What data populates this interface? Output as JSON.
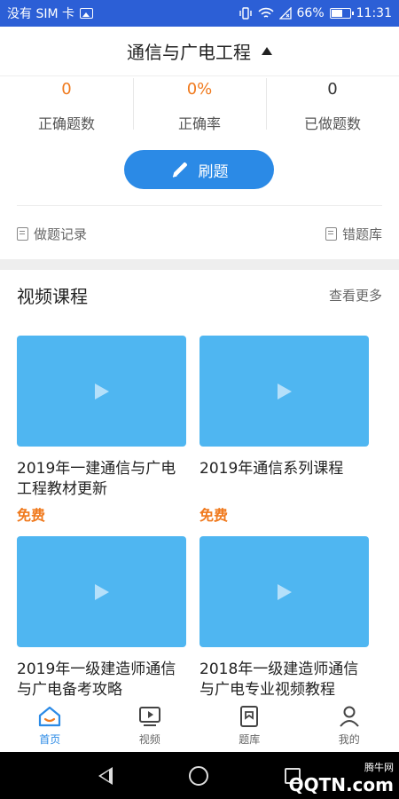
{
  "status_bar": {
    "carrier": "没有 SIM 卡",
    "battery": "66%",
    "battery_level": 0.66,
    "time": "11:31"
  },
  "header": {
    "title": "通信与广电工程"
  },
  "stats": [
    {
      "value": "0",
      "label": "正确题数",
      "color": "#f07a1e"
    },
    {
      "value": "0%",
      "label": "正确率",
      "color": "#f07a1e"
    },
    {
      "value": "0",
      "label": "已做题数",
      "color": "#333333"
    }
  ],
  "practice_button": {
    "label": "刷题"
  },
  "links": {
    "history": "做题记录",
    "wrong_bank": "错题库"
  },
  "section": {
    "title": "视频课程",
    "more": "查看更多"
  },
  "courses": [
    {
      "title": "2019年一建通信与广电工程教材更新",
      "price": "免费"
    },
    {
      "title": "2019年通信系列课程",
      "price": "免费"
    },
    {
      "title": "2019年一级建造师通信与广电备考攻略",
      "price": ""
    },
    {
      "title": "2018年一级建造师通信与广电专业视频教程",
      "price": ""
    }
  ],
  "tabs": [
    {
      "label": "首页",
      "icon": "home-icon",
      "active": true
    },
    {
      "label": "视频",
      "icon": "video-icon",
      "active": false
    },
    {
      "label": "题库",
      "icon": "question-bank-icon",
      "active": false
    },
    {
      "label": "我的",
      "icon": "profile-icon",
      "active": false
    }
  ],
  "watermark": {
    "text": "QQTN.com",
    "subtext": "腾牛网"
  },
  "colors": {
    "primary": "#2b8ae6",
    "accent": "#f07a1e",
    "thumb": "#4fb6f1",
    "status_bar": "#2c5fd6"
  }
}
